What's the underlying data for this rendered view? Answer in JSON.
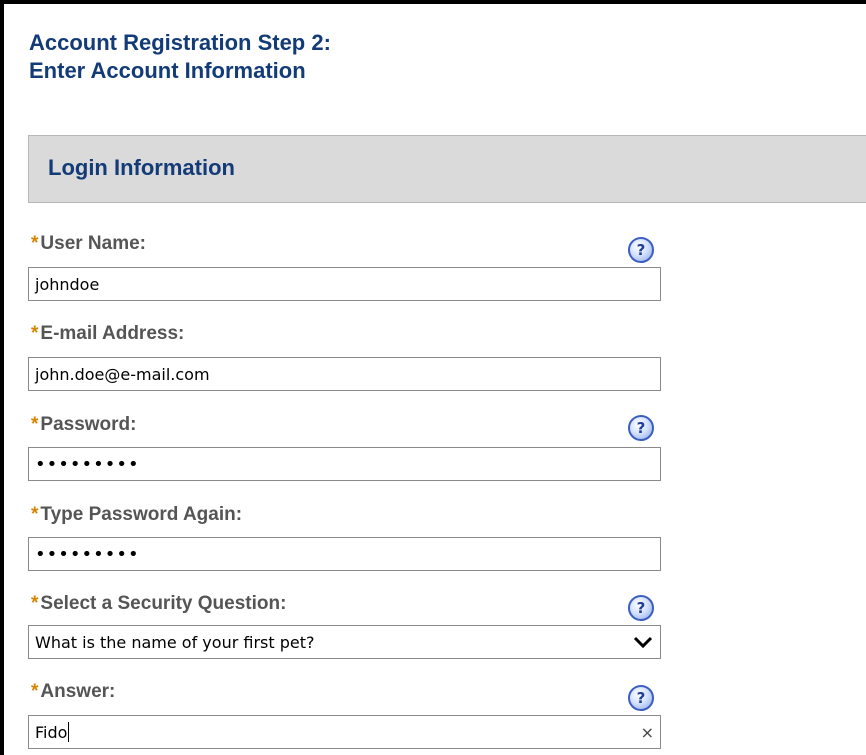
{
  "page": {
    "title_line1": "Account Registration Step 2:",
    "title_line2": "Enter Account Information"
  },
  "section": {
    "title": "Login Information"
  },
  "fields": {
    "required_marker": "*",
    "username": {
      "label": "User Name:",
      "value": "johndoe"
    },
    "email": {
      "label": "E-mail Address:",
      "value": "john.doe@e-mail.com"
    },
    "password": {
      "label": "Password:",
      "value": "•••••••••"
    },
    "password_again": {
      "label": "Type Password Again:",
      "value": "•••••••••"
    },
    "security_question": {
      "label": "Select a Security Question:",
      "value": "What is the name of your first pet?"
    },
    "answer": {
      "label": "Answer:",
      "value": "Fido"
    }
  },
  "icons": {
    "help": "?",
    "clear": "×",
    "dropdown": "chevron-down-icon"
  }
}
